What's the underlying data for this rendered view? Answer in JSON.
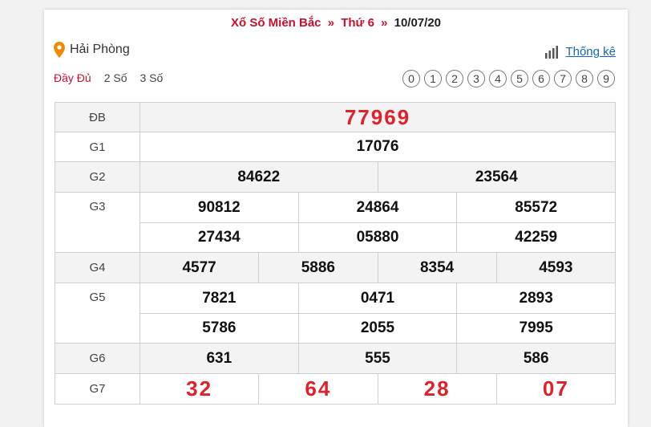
{
  "header": {
    "title": "Xổ Số Miền Bắc",
    "sep1": "»",
    "day": "Thứ 6",
    "sep2": "»",
    "date": "10/07/20"
  },
  "location": {
    "name": "Hải Phòng",
    "icon": "map-pin-icon"
  },
  "stats": {
    "label": "Thống kê",
    "icon": "bar-chart-icon"
  },
  "modes": [
    "Đầy Đủ",
    "2 Số",
    "3 Số"
  ],
  "digits": [
    "0",
    "1",
    "2",
    "3",
    "4",
    "5",
    "6",
    "7",
    "8",
    "9"
  ],
  "colors": {
    "accent": "#c8102e",
    "prize_red": "#e0202a",
    "link": "#1565c0"
  },
  "prizes": {
    "db": {
      "label": "ĐB",
      "values": [
        "77969"
      ]
    },
    "g1": {
      "label": "G1",
      "values": [
        "17076"
      ]
    },
    "g2": {
      "label": "G2",
      "values": [
        "84622",
        "23564"
      ]
    },
    "g3": {
      "label": "G3",
      "values": [
        "90812",
        "24864",
        "85572",
        "27434",
        "05880",
        "42259"
      ]
    },
    "g4": {
      "label": "G4",
      "values": [
        "4577",
        "5886",
        "8354",
        "4593"
      ]
    },
    "g5": {
      "label": "G5",
      "values": [
        "7821",
        "0471",
        "2893",
        "5786",
        "2055",
        "7995"
      ]
    },
    "g6": {
      "label": "G6",
      "values": [
        "631",
        "555",
        "586"
      ]
    },
    "g7": {
      "label": "G7",
      "values": [
        "32",
        "64",
        "28",
        "07"
      ]
    }
  }
}
